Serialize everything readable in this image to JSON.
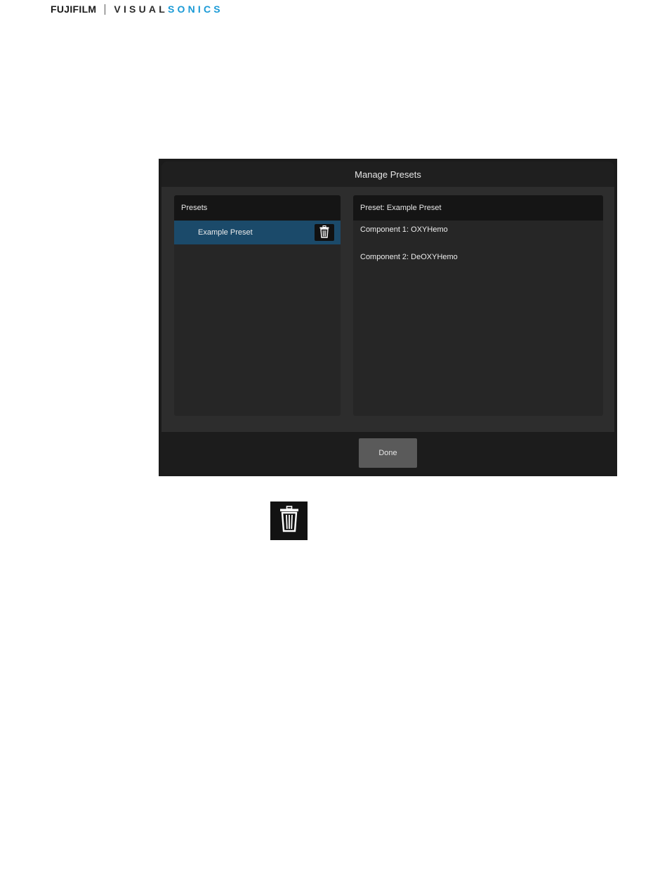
{
  "brand": {
    "fujifilm": "FUJIFILM",
    "visual": "VISUAL",
    "sonics": "SONICS",
    "accent_color": "#1a9ad6"
  },
  "dialog": {
    "title": "Manage Presets",
    "presets_panel": {
      "header": "Presets",
      "items": [
        {
          "label": "Example Preset",
          "selected": true,
          "action_icon": "trash-icon"
        }
      ]
    },
    "detail_panel": {
      "header": "Preset: Example Preset",
      "components": [
        "Component 1: OXYHemo",
        "Component 2: DeOXYHemo"
      ]
    },
    "done_label": "Done",
    "colors": {
      "selected_row": "#1b4a6a",
      "dialog_bg": "#2d2d2d",
      "button_bg": "#5a5a5a"
    }
  },
  "reference_icon": {
    "name": "trash-icon"
  }
}
